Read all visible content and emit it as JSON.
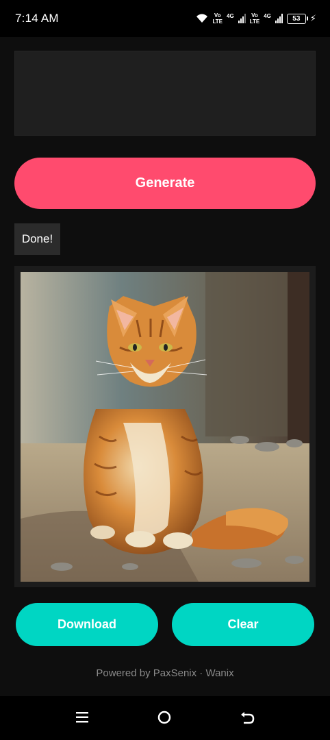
{
  "status_bar": {
    "time": "7:14 AM",
    "sim1_top": "Vo",
    "sim1_bottom": "LTE",
    "sim1_network": "4G",
    "sim2_top": "Vo",
    "sim2_bottom": "LTE",
    "sim2_network": "4G",
    "battery_level": "53",
    "icons": [
      "wifi-icon",
      "signal-icon",
      "battery-icon",
      "charging-icon"
    ]
  },
  "prompt": {
    "value": "",
    "placeholder": ""
  },
  "actions": {
    "generate_label": "Generate",
    "download_label": "Download",
    "clear_label": "Clear"
  },
  "status_text": "Done!",
  "footer_text": "Powered by PaxSenix · Wanix",
  "nav_bar": {
    "icons": [
      "menu-icon",
      "home-icon",
      "back-icon"
    ]
  },
  "colors": {
    "background": "#0e0e0e",
    "generate": "#ff4b6e",
    "secondary_buttons": "#00d6c3",
    "panel": "#1f1f1f"
  }
}
